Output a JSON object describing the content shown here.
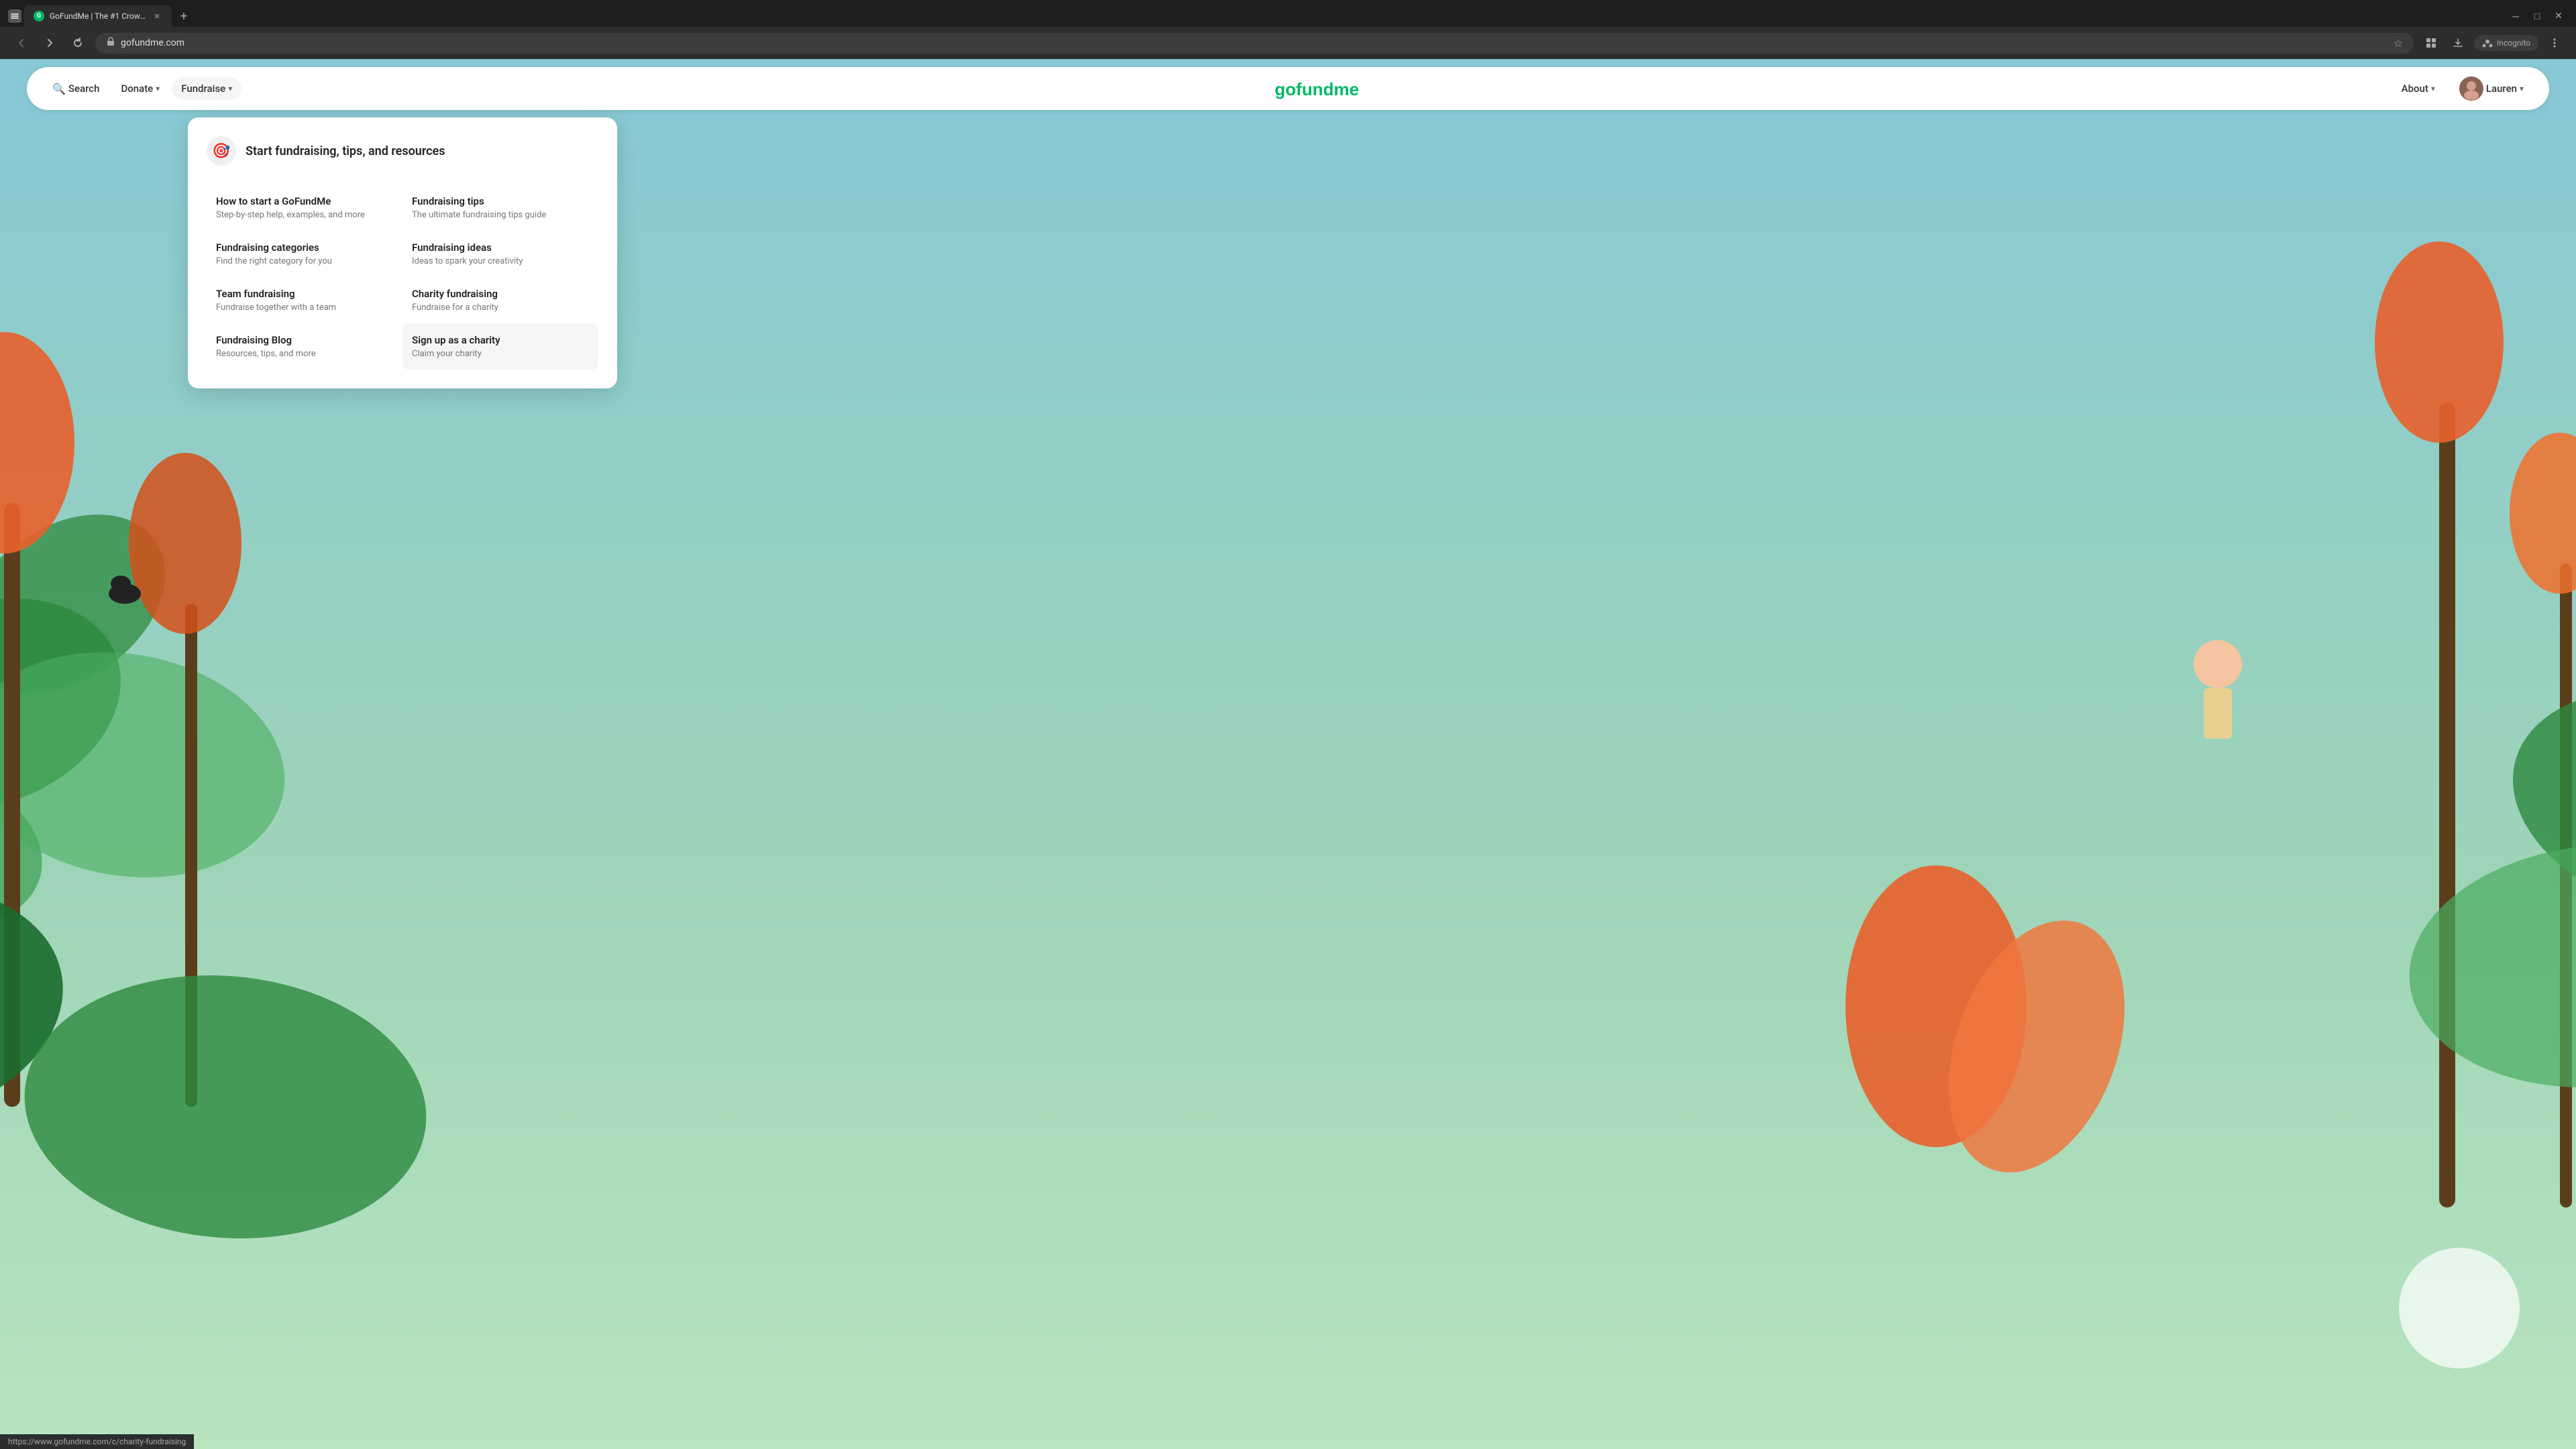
{
  "browser": {
    "tab_title": "GoFundMe | The #1 Crowdfund...",
    "tab_favicon": "G",
    "address": "gofundme.com",
    "new_tab_label": "+",
    "incognito_label": "Incognito",
    "status_url": "https://www.gofundme.com/c/charity-fundraising"
  },
  "navbar": {
    "search_label": "Search",
    "donate_label": "Donate",
    "fundraise_label": "Fundraise",
    "about_label": "About",
    "user_label": "Lauren",
    "logo_text": "gofundme"
  },
  "fundraise_dropdown": {
    "header_icon": "🎯",
    "header_text": "Start fundraising, tips, and resources",
    "items": [
      {
        "title": "How to start a GoFundMe",
        "desc": "Step-by-step help, examples, and more",
        "highlighted": false
      },
      {
        "title": "Fundraising tips",
        "desc": "The ultimate fundraising tips guide",
        "highlighted": false
      },
      {
        "title": "Fundraising categories",
        "desc": "Find the right category for you",
        "highlighted": false
      },
      {
        "title": "Fundraising ideas",
        "desc": "Ideas to spark your creativity",
        "highlighted": false
      },
      {
        "title": "Team fundraising",
        "desc": "Fundraise together with a team",
        "highlighted": false
      },
      {
        "title": "Charity fundraising",
        "desc": "Fundraise for a charity",
        "highlighted": false
      },
      {
        "title": "Fundraising Blog",
        "desc": "Resources, tips, and more",
        "highlighted": false
      },
      {
        "title": "Sign up as a charity",
        "desc": "Claim your charity",
        "highlighted": true
      }
    ]
  }
}
